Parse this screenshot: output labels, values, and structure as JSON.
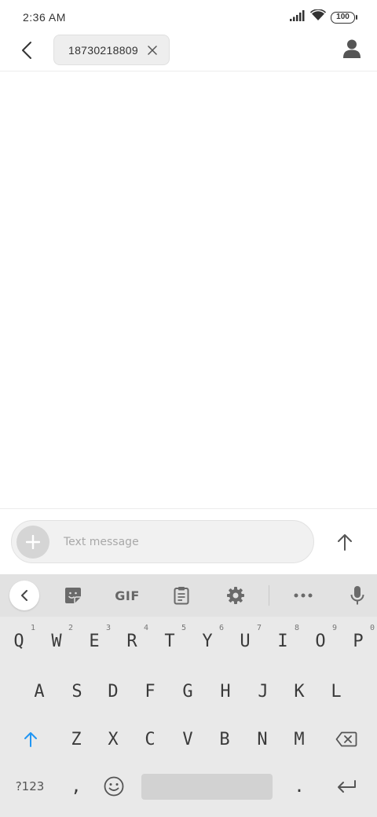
{
  "status_bar": {
    "time": "2:36 AM",
    "battery": "100"
  },
  "header": {
    "back_icon": "chevron-left-icon",
    "recipient_number": "18730218809",
    "remove_icon": "close-icon",
    "contact_icon": "person-icon"
  },
  "compose": {
    "placeholder": "Text message",
    "attach_icon": "plus-icon",
    "send_icon": "arrow-up-icon"
  },
  "keyboard": {
    "toolbar": {
      "collapse_icon": "chevron-left-icon",
      "sticker_icon": "sticker-icon",
      "gif_label": "GIF",
      "clipboard_icon": "clipboard-icon",
      "settings_icon": "gear-icon",
      "more_icon": "more-horiz-icon",
      "mic_icon": "microphone-icon"
    },
    "row1": [
      {
        "key": "Q",
        "hint": "1"
      },
      {
        "key": "W",
        "hint": "2"
      },
      {
        "key": "E",
        "hint": "3"
      },
      {
        "key": "R",
        "hint": "4"
      },
      {
        "key": "T",
        "hint": "5"
      },
      {
        "key": "Y",
        "hint": "6"
      },
      {
        "key": "U",
        "hint": "7"
      },
      {
        "key": "I",
        "hint": "8"
      },
      {
        "key": "O",
        "hint": "9"
      },
      {
        "key": "P",
        "hint": "0"
      }
    ],
    "row2": [
      "A",
      "S",
      "D",
      "F",
      "G",
      "H",
      "J",
      "K",
      "L"
    ],
    "row3": [
      "Z",
      "X",
      "C",
      "V",
      "B",
      "N",
      "M"
    ],
    "symbols_label": "?123",
    "comma": ",",
    "period": ".",
    "shift_icon": "shift-arrow-icon",
    "backspace_icon": "backspace-icon",
    "emoji_icon": "emoji-icon",
    "enter_icon": "enter-icon"
  },
  "colors": {
    "accent": "#2196F3",
    "keyboard_bg": "#e9e9e9",
    "toolbar_bg": "#e2e2e2"
  }
}
